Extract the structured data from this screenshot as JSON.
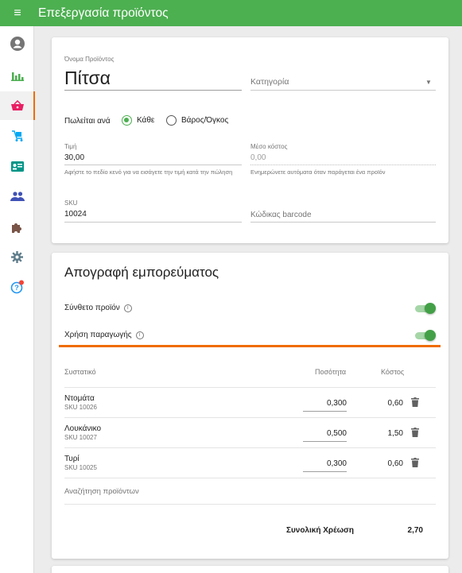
{
  "appbar": {
    "title": "Επεξεργασία προϊόντος"
  },
  "product": {
    "name_label": "Όνομα Προϊόντος",
    "name_value": "Πίτσα",
    "category_placeholder": "Κατηγορία",
    "sold_by_label": "Πωλείται ανά",
    "option_each": "Κάθε",
    "option_weight": "Βάρος/Όγκος",
    "price_label": "Τιμή",
    "price_value": "30,00",
    "price_help": "Αφήστε το πεδίο κενό για να εισάγετε την τιμή κατά την πώληση",
    "cost_label": "Μέσο κόστος",
    "cost_value": "0,00",
    "cost_help": "Ενημερώνετε αυτόματα όταν παράγεται ένα προϊόν",
    "sku_label": "SKU",
    "sku_value": "10024",
    "barcode_placeholder": "Κώδικας barcode"
  },
  "inventory": {
    "title": "Απογραφή εμπορεύματος",
    "composite_label": "Σύνθετο προϊόν",
    "production_label": "Χρήση παραγωγής",
    "col_ingredient": "Συστατικό",
    "col_quantity": "Ποσότητα",
    "col_cost": "Κόστος",
    "items": [
      {
        "name": "Ντομάτα",
        "sku": "SKU 10026",
        "qty": "0,300",
        "cost": "0,60"
      },
      {
        "name": "Λουκάνικο",
        "sku": "SKU 10027",
        "qty": "0,500",
        "cost": "1,50"
      },
      {
        "name": "Τυρί",
        "sku": "SKU 10025",
        "qty": "0,300",
        "cost": "0,60"
      }
    ],
    "search_placeholder": "Αναζήτηση προϊόντων",
    "total_label": "Συνολική Χρέωση",
    "total_value": "2,70"
  },
  "colors": {
    "brand": "#4caf50",
    "accent": "#ef6c00",
    "info_badge": "#f44336"
  },
  "sidebar_icons": [
    "account-icon",
    "reports-icon",
    "items-icon",
    "inventory-icon",
    "employees-icon",
    "customers-icon",
    "integrations-icon",
    "settings-icon",
    "help-icon"
  ]
}
